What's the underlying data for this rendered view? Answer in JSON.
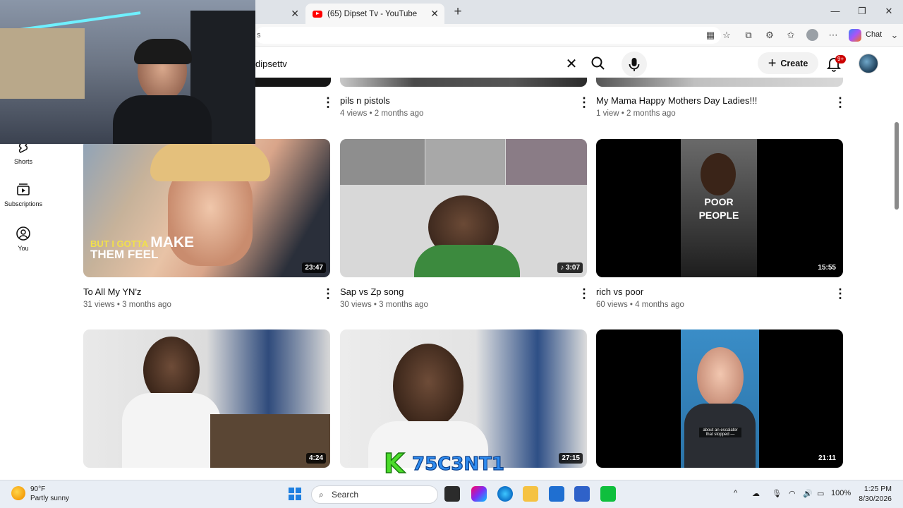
{
  "browser": {
    "tabs": [
      {
        "label": "",
        "active": false
      },
      {
        "label": "(65) Dipset Tv - YouTube",
        "active": true
      }
    ],
    "url": "s",
    "chat_label": "Chat"
  },
  "youtube": {
    "search_query": "dipsettv",
    "create_label": "Create",
    "notification_count": "9+",
    "guide": [
      {
        "label": "Shorts",
        "icon": "shorts-icon"
      },
      {
        "label": "Subscriptions",
        "icon": "subscriptions-icon"
      },
      {
        "label": "You",
        "icon": "you-icon"
      }
    ],
    "videos": [
      {
        "title": "pils n pistols",
        "meta": "4 views • 2 months ago",
        "duration": ""
      },
      {
        "title": "My Mama Happy Mothers Day Ladies!!!",
        "meta": "1 view • 2 months ago",
        "duration": ""
      },
      {
        "title": "To All My YN'z",
        "meta": "31 views • 3 months ago",
        "duration": "23:47",
        "thumb_text_a": "BUT I GOTTA",
        "thumb_text_b": "MAKE",
        "thumb_text_c": "THEM FEEL"
      },
      {
        "title": "Sap vs Zp song",
        "meta": "30 views • 3 months ago",
        "duration": "3:07"
      },
      {
        "title": "rich vs poor",
        "meta": "60 views • 4 months ago",
        "duration": "15:55",
        "thumb_text_a": "POOR",
        "thumb_text_b": "PEOPLE"
      },
      {
        "title": "",
        "meta": "",
        "duration": "4:24"
      },
      {
        "title": "",
        "meta": "",
        "duration": "27:15"
      },
      {
        "title": "",
        "meta": "",
        "duration": "21:11",
        "thumb_caption": "about an escalator that stopped —"
      }
    ]
  },
  "watermark_text": "K75C3NT1",
  "taskbar": {
    "weather_temp": "90°F",
    "weather_desc": "Partly sunny",
    "search_label": "Search",
    "battery": "100%",
    "time": "1:25 PM",
    "date": "8/30/2026"
  }
}
